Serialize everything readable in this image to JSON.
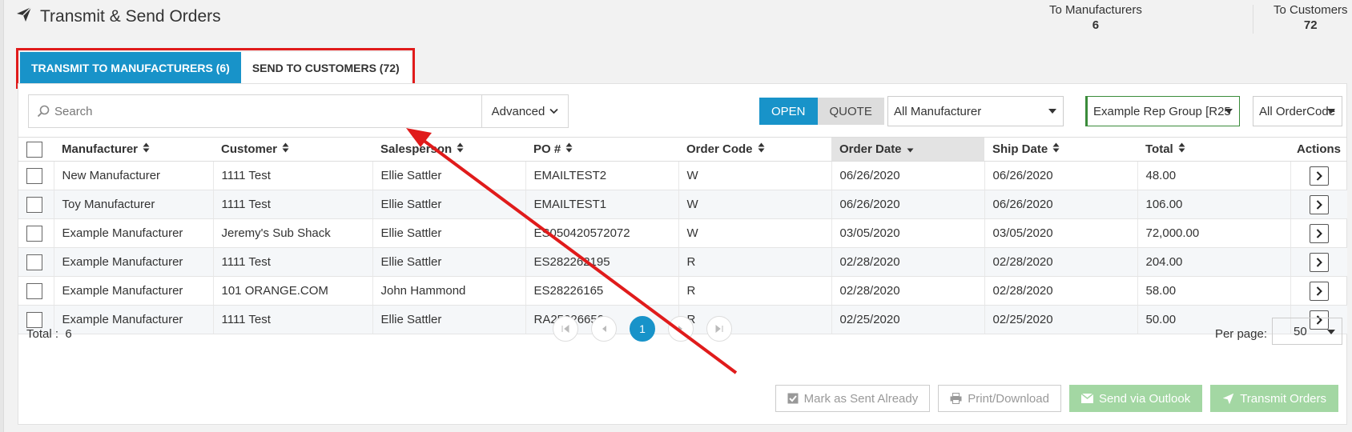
{
  "header": {
    "title": "Transmit & Send Orders"
  },
  "stats": [
    {
      "label": "To Manufacturers",
      "value": "6"
    },
    {
      "label": "To Customers",
      "value": "72"
    }
  ],
  "tabs": [
    {
      "label": "TRANSMIT TO MANUFACTURERS (6)",
      "active": true
    },
    {
      "label": "SEND TO CUSTOMERS (72)",
      "active": false
    }
  ],
  "toolbar": {
    "search_placeholder": "Search",
    "advanced_label": "Advanced",
    "status_open": "OPEN",
    "status_quote": "QUOTE",
    "manufacturer_filter": "All Manufacturer",
    "rep_group_filter": "Example Rep Group [R25",
    "ordercode_filter": "All OrderCode"
  },
  "table": {
    "headers": [
      "Manufacturer",
      "Customer",
      "Salesperson",
      "PO #",
      "Order Code",
      "Order Date",
      "Ship Date",
      "Total",
      "Actions"
    ],
    "rows": [
      [
        "New Manufacturer",
        "1111 Test",
        "Ellie Sattler",
        "EMAILTEST2",
        "W",
        "06/26/2020",
        "06/26/2020",
        "48.00"
      ],
      [
        "Toy Manufacturer",
        "1111 Test",
        "Ellie Sattler",
        "EMAILTEST1",
        "W",
        "06/26/2020",
        "06/26/2020",
        "106.00"
      ],
      [
        "Example Manufacturer",
        "Jeremy's Sub Shack",
        "Ellie Sattler",
        "ES050420572072",
        "W",
        "03/05/2020",
        "03/05/2020",
        "72,000.00"
      ],
      [
        "Example Manufacturer",
        "1111 Test",
        "Ellie Sattler",
        "ES282262195",
        "R",
        "02/28/2020",
        "02/28/2020",
        "204.00"
      ],
      [
        "Example Manufacturer",
        "101 ORANGE.COM",
        "John Hammond",
        "ES28226165",
        "R",
        "02/28/2020",
        "02/28/2020",
        "58.00"
      ],
      [
        "Example Manufacturer",
        "1111 Test",
        "Ellie Sattler",
        "RA25226652",
        "R",
        "02/25/2020",
        "02/25/2020",
        "50.00"
      ]
    ]
  },
  "footer": {
    "total_label": "Total :",
    "total_value": "6",
    "current_page": "1",
    "per_page_label": "Per page:",
    "per_page_value": "50"
  },
  "actions": {
    "mark_sent": "Mark as Sent Already",
    "print": "Print/Download",
    "outlook": "Send via Outlook",
    "transmit": "Transmit Orders"
  },
  "colors": {
    "accent": "#1893c9",
    "highlight": "#e01b1b",
    "success_disabled": "#a3d7a3"
  }
}
